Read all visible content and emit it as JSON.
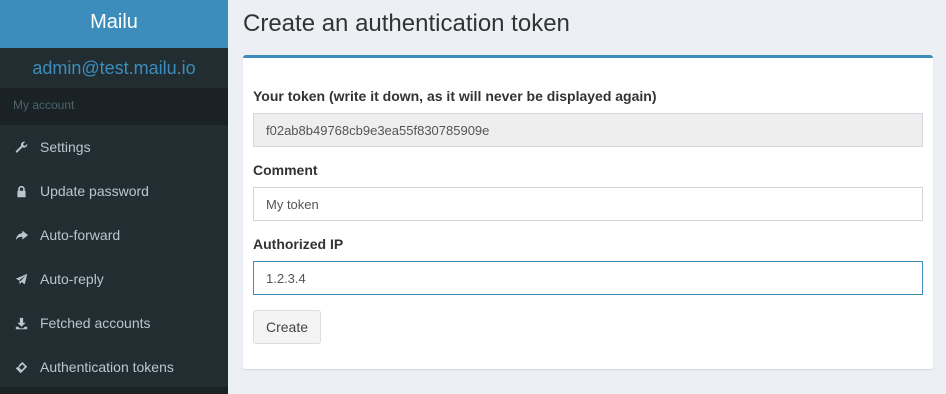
{
  "app": {
    "logo": "Mailu"
  },
  "user": {
    "email": "admin@test.mailu.io"
  },
  "sidebar": {
    "section_header": "My account",
    "items": [
      {
        "label": "Settings",
        "icon": "wrench-icon"
      },
      {
        "label": "Update password",
        "icon": "lock-icon"
      },
      {
        "label": "Auto-forward",
        "icon": "share-arrow-icon"
      },
      {
        "label": "Auto-reply",
        "icon": "plane-icon"
      },
      {
        "label": "Fetched accounts",
        "icon": "download-icon"
      },
      {
        "label": "Authentication tokens",
        "icon": "ticket-icon"
      }
    ]
  },
  "page": {
    "title": "Create an authentication token"
  },
  "form": {
    "token_label": "Your token (write it down, as it will never be displayed again)",
    "token_value": "f02ab8b49768cb9e3ea55f830785909e",
    "comment_label": "Comment",
    "comment_value": "My token",
    "ip_label": "Authorized IP",
    "ip_value": "1.2.3.4",
    "submit_label": "Create"
  },
  "colors": {
    "accent": "#3c8dbc",
    "sidebar_bg": "#222d32",
    "sidebar_text": "#b8c7ce"
  }
}
